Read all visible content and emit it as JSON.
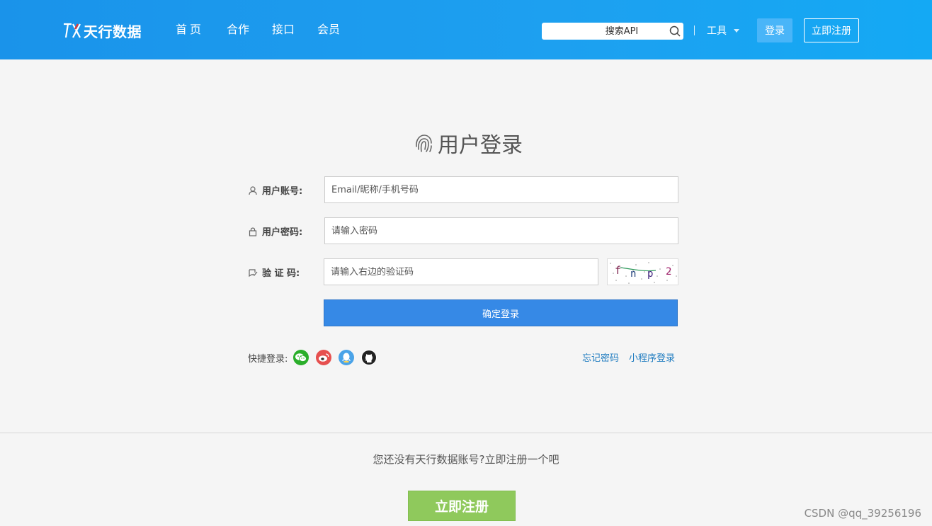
{
  "header": {
    "logo_text": "天行数据",
    "nav": [
      "首页",
      "合作",
      "接口",
      "会员"
    ],
    "search_placeholder": "搜索API",
    "tools_label": "工具",
    "login_label": "登录",
    "register_label": "立即注册"
  },
  "login": {
    "title": "用户登录",
    "account_label": "用户账号:",
    "account_placeholder": "Email/昵称/手机号码",
    "password_label": "用户密码:",
    "password_placeholder": "请输入密码",
    "captcha_label": "验 证 码:",
    "captcha_placeholder": "请输入右边的验证码",
    "captcha_text": "f n p 2",
    "submit_label": "确定登录",
    "quick_login_label": "快捷登录:",
    "quick_login_icons": [
      "wechat-icon",
      "weibo-icon",
      "qq-icon",
      "github-icon"
    ],
    "forgot_label": "忘记密码",
    "miniprogram_label": "小程序登录"
  },
  "footer": {
    "register_hint": "您还没有天行数据账号?立即注册一个吧",
    "register_button": "立即注册",
    "watermark": "CSDN @qq_39256196"
  },
  "colors": {
    "header": "#1da0f0",
    "primary": "#3689e6",
    "register": "#8fc95c",
    "link": "#1f7cc0"
  }
}
